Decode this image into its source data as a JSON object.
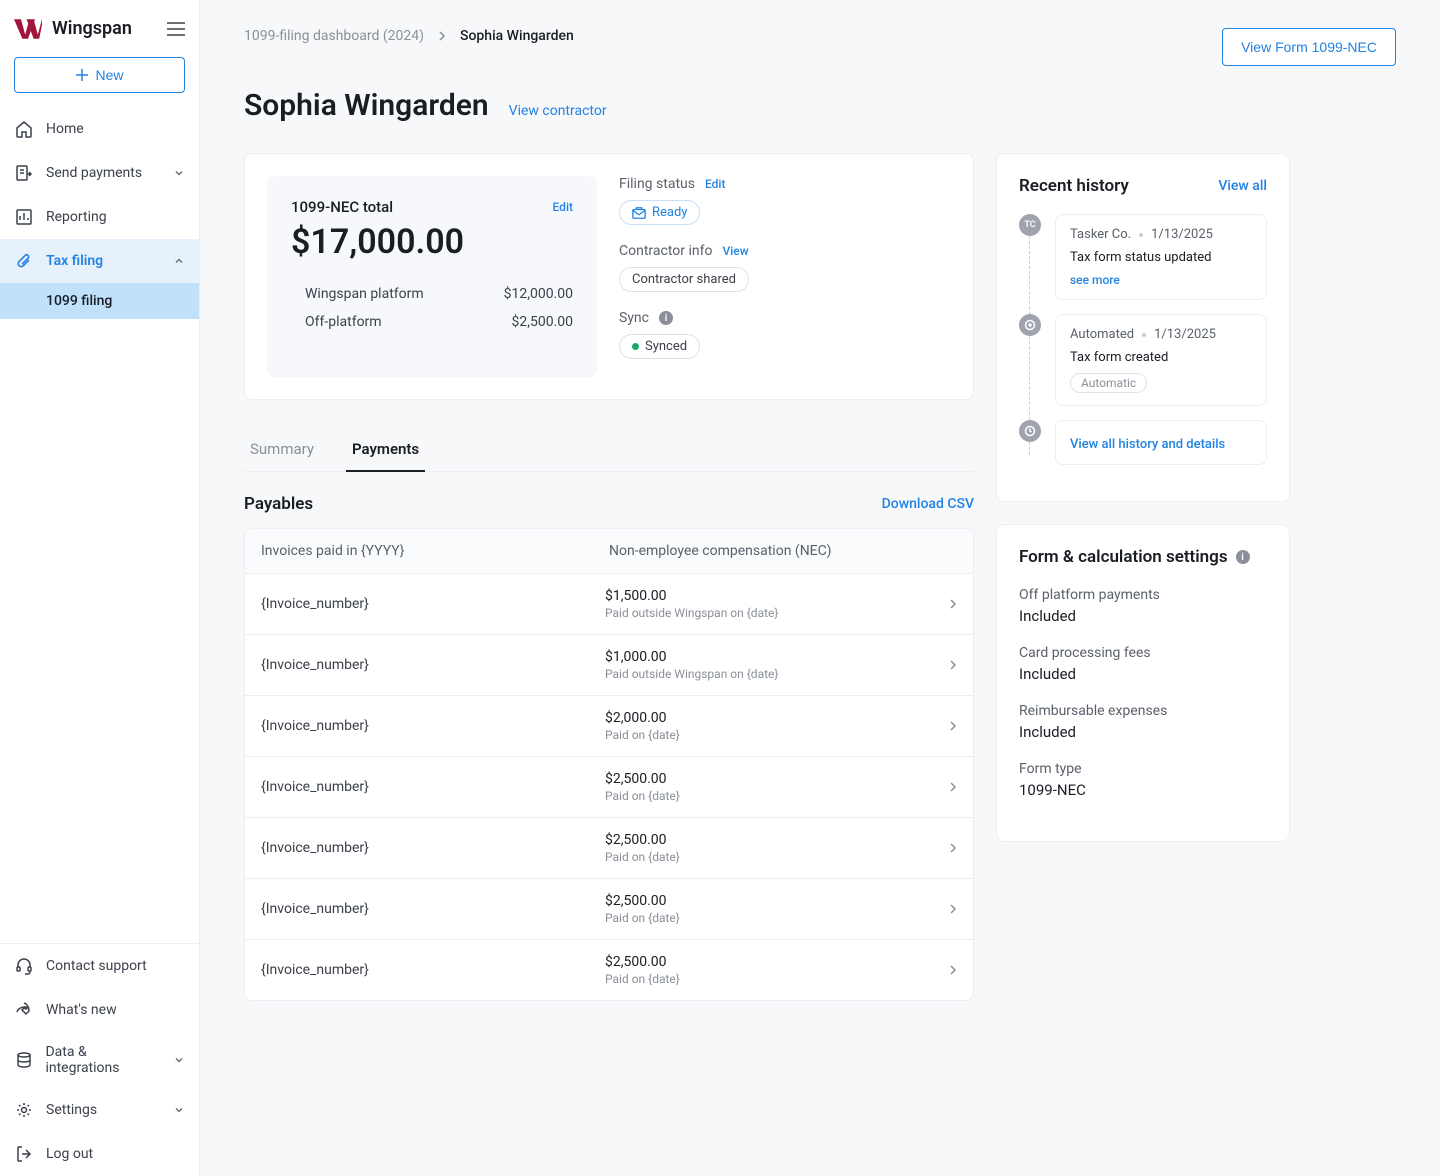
{
  "app": {
    "name": "Wingspan"
  },
  "sidebar": {
    "new_label": "New",
    "top_items": [
      {
        "label": "Home",
        "icon": "home"
      },
      {
        "label": "Send payments",
        "icon": "send",
        "expandable": true
      },
      {
        "label": "Reporting",
        "icon": "report"
      },
      {
        "label": "Tax filing",
        "icon": "tax",
        "expandable": true,
        "active": true
      }
    ],
    "tax_sub": {
      "label": "1099 filing"
    },
    "bottom_items": [
      {
        "label": "Contact support",
        "icon": "support"
      },
      {
        "label": "What's new",
        "icon": "rocket"
      },
      {
        "label": "Data & integrations",
        "icon": "data",
        "expandable": true
      },
      {
        "label": "Settings",
        "icon": "gear",
        "expandable": true
      },
      {
        "label": "Log out",
        "icon": "logout"
      }
    ]
  },
  "breadcrumb": {
    "root": "1099-filing dashboard (2024)",
    "current": "Sophia Wingarden"
  },
  "header": {
    "title": "Sophia Wingarden",
    "view_contractor": "View contractor",
    "view_form_btn": "View Form 1099-NEC"
  },
  "total": {
    "title": "1099-NEC total",
    "edit": "Edit",
    "amount": "$17,000.00",
    "rows": [
      {
        "label": "Wingspan platform",
        "value": "$12,000.00"
      },
      {
        "label": "Off-platform",
        "value": "$2,500.00"
      }
    ]
  },
  "status": {
    "filing_label": "Filing status",
    "filing_edit": "Edit",
    "filing_value": "Ready",
    "contractor_label": "Contractor info",
    "contractor_view": "View",
    "contractor_value": "Contractor shared",
    "sync_label": "Sync",
    "sync_value": "Synced"
  },
  "tabs": {
    "summary": "Summary",
    "payments": "Payments"
  },
  "payables": {
    "title": "Payables",
    "download": "Download CSV",
    "col1": "Invoices paid in {YYYY}",
    "col2": "Non-employee compensation (NEC)",
    "rows": [
      {
        "invoice": "{Invoice_number}",
        "amount": "$1,500.00",
        "sub": "Paid outside Wingspan on {date}"
      },
      {
        "invoice": "{Invoice_number}",
        "amount": "$1,000.00",
        "sub": "Paid outside Wingspan on {date}"
      },
      {
        "invoice": "{Invoice_number}",
        "amount": "$2,000.00",
        "sub": "Paid on {date}"
      },
      {
        "invoice": "{Invoice_number}",
        "amount": "$2,500.00",
        "sub": "Paid on {date}"
      },
      {
        "invoice": "{Invoice_number}",
        "amount": "$2,500.00",
        "sub": "Paid on {date}"
      },
      {
        "invoice": "{Invoice_number}",
        "amount": "$2,500.00",
        "sub": "Paid on {date}"
      },
      {
        "invoice": "{Invoice_number}",
        "amount": "$2,500.00",
        "sub": "Paid on {date}"
      }
    ]
  },
  "history": {
    "title": "Recent history",
    "view_all": "View all",
    "items": [
      {
        "icon": "TC",
        "who": "Tasker Co.",
        "date": "1/13/2025",
        "text": "Tax form status updated",
        "see_more": "see more"
      },
      {
        "icon": "⊙",
        "who": "Automated",
        "date": "1/13/2025",
        "text": "Tax form created",
        "pill": "Automatic"
      }
    ],
    "view_link": "View all history and details"
  },
  "settings": {
    "title": "Form & calculation settings",
    "items": [
      {
        "label": "Off platform payments",
        "value": "Included"
      },
      {
        "label": "Card processing fees",
        "value": "Included"
      },
      {
        "label": "Reimbursable expenses",
        "value": "Included"
      },
      {
        "label": "Form type",
        "value": "1099-NEC"
      }
    ]
  }
}
